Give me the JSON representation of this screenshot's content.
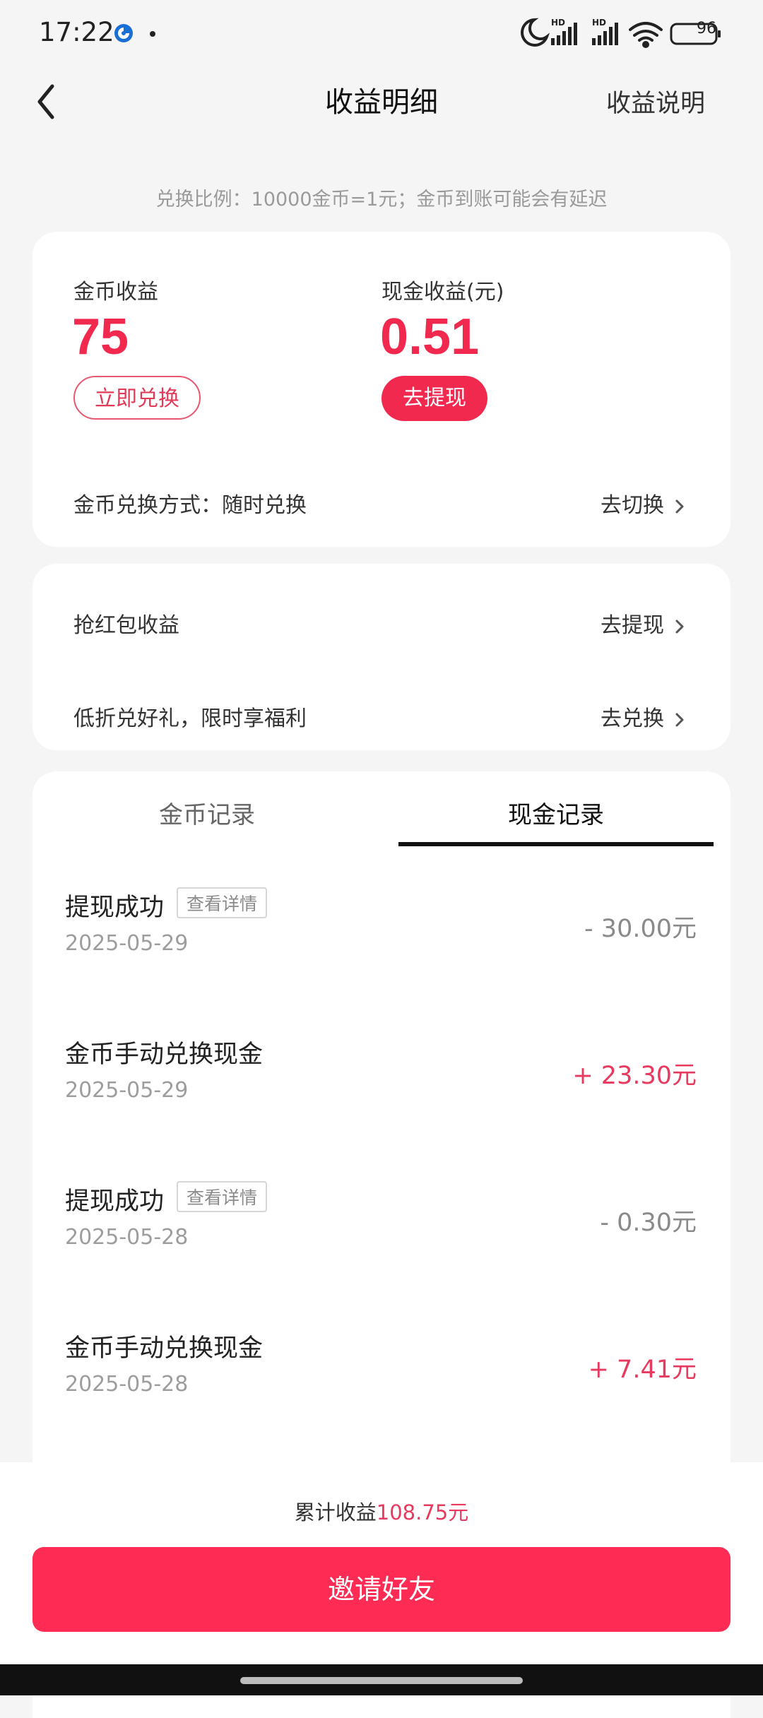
{
  "status_bar": {
    "time": "17:22",
    "battery": "96",
    "icons": [
      "moon-icon",
      "signal-hd-icon",
      "signal-hd-icon",
      "wifi-icon",
      "battery-icon"
    ]
  },
  "header": {
    "title": "收益明细",
    "right_link": "收益说明",
    "back_icon": "chevron-left-icon"
  },
  "ratio_note": "兑换比例：10000金币=1元；金币到账可能会有延迟",
  "earnings": {
    "coin_label": "金币收益",
    "coin_value": "75",
    "coin_button": "立即兑换",
    "cash_label": "现金收益(元)",
    "cash_value": "0.51",
    "cash_button": "去提现",
    "exchange_mode": "金币兑换方式：随时兑换",
    "exchange_switch": "去切换"
  },
  "promo": {
    "items": [
      {
        "label": "抢红包收益",
        "action": "去提现"
      },
      {
        "label": "低折兑好礼，限时享福利",
        "action": "去兑换"
      }
    ]
  },
  "records": {
    "tabs": [
      {
        "label": "金币记录",
        "active": false
      },
      {
        "label": "现金记录",
        "active": true
      }
    ],
    "items": [
      {
        "title": "提现成功",
        "tag": "查看详情",
        "date": "2025-05-29",
        "amount": "- 30.00元",
        "sign": "neg"
      },
      {
        "title": "金币手动兑换现金",
        "tag": "",
        "date": "2025-05-29",
        "amount": "+ 23.30元",
        "sign": "pos"
      },
      {
        "title": "提现成功",
        "tag": "查看详情",
        "date": "2025-05-28",
        "amount": "- 0.30元",
        "sign": "neg"
      },
      {
        "title": "金币手动兑换现金",
        "tag": "",
        "date": "2025-05-28",
        "amount": "+ 7.41元",
        "sign": "pos"
      }
    ]
  },
  "footer": {
    "total_label": "累计收益",
    "total_value": "108.75元",
    "invite_button": "邀请好友"
  },
  "colors": {
    "accent": "#fe2c55",
    "positive": "#e73a5e",
    "negative": "#8a8a8a",
    "background": "#f5f5f5"
  }
}
